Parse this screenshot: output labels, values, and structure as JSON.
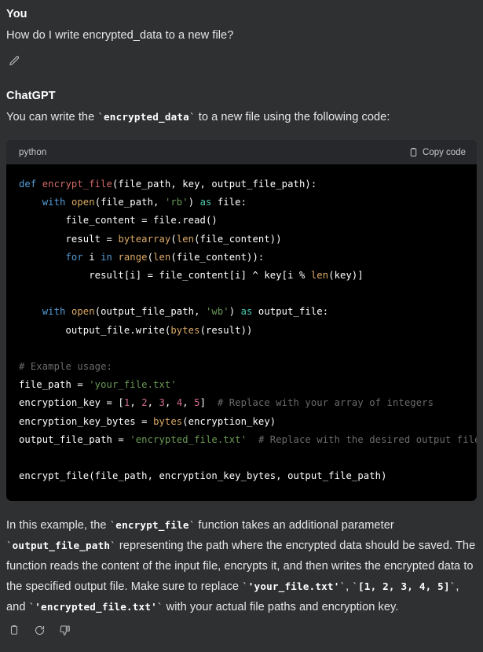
{
  "theme": {
    "page_bg": "#2f3032",
    "code_bg": "#000000",
    "code_header_bg": "#27282b",
    "text": "#e6e6e9",
    "muted": "#b9bbbe"
  },
  "user_message": {
    "author": "You",
    "text": "How do I write encrypted_data to a new file?",
    "edit_icon": "pencil-icon"
  },
  "assistant_message": {
    "author": "ChatGPT",
    "intro": {
      "before": "You can write the ",
      "code": "encrypted_data",
      "after": " to a new file using the following code:"
    },
    "code_block": {
      "language": "python",
      "copy_label": "Copy code",
      "copy_icon": "clipboard-icon",
      "lines": [
        "def encrypt_file(file_path, key, output_file_path):",
        "    with open(file_path, 'rb') as file:",
        "        file_content = file.read()",
        "        result = bytearray(len(file_content))",
        "        for i in range(len(file_content)):",
        "            result[i] = file_content[i] ^ key[i % len(key)]",
        "",
        "    with open(output_file_path, 'wb') as output_file:",
        "        output_file.write(bytes(result))",
        "",
        "# Example usage:",
        "file_path = 'your_file.txt'",
        "encryption_key = [1, 2, 3, 4, 5]  # Replace with your array of integers",
        "encryption_key_bytes = bytes(encryption_key)",
        "output_file_path = 'encrypted_file.txt'  # Replace with the desired output file path",
        "",
        "encrypt_file(file_path, encryption_key_bytes, output_file_path)"
      ]
    },
    "explanation": {
      "p1": "In this example, the ",
      "c1": "encrypt_file",
      "p2": " function takes an additional parameter ",
      "c2": "output_file_path",
      "p3": " representing the path where the encrypted data should be saved. The function reads the content of the input file, encrypts it, and then writes the encrypted data to the specified output file. Make sure to replace ",
      "c3": "'your_file.txt'",
      "p4": ", ",
      "c4": "[1, 2, 3, 4, 5]",
      "p5": ", and ",
      "c5": "'encrypted_file.txt'",
      "p6": " with your actual file paths and encryption key."
    },
    "actions": [
      {
        "name": "copy-button",
        "icon": "clipboard-icon"
      },
      {
        "name": "regenerate-button",
        "icon": "refresh-icon"
      },
      {
        "name": "thumbs-down-button",
        "icon": "thumbs-down-icon"
      }
    ]
  }
}
